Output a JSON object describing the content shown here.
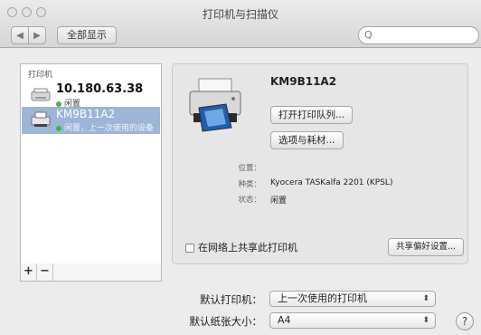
{
  "window": {
    "title": "打印机与扫描仪"
  },
  "toolbar": {
    "back_glyph": "◀",
    "forward_glyph": "▶",
    "show_all_label": "全部显示",
    "search_glyph": "Q",
    "search_value": ""
  },
  "printers": {
    "header": "打印机",
    "items": [
      {
        "name": "10.180.63.38",
        "status": "闲置",
        "selected": false
      },
      {
        "name": "KM9B11A2",
        "status": "闲置，上一次使用的设备",
        "selected": true
      }
    ],
    "add_label": "+",
    "remove_label": "−"
  },
  "details": {
    "name": "KM9B11A2",
    "open_queue_label": "打开打印队列...",
    "options_label": "选项与耗材...",
    "location_label": "位置：",
    "location_value": "",
    "kind_label": "种类：",
    "kind_value": "Kyocera TASKalfa 2201 (KPSL)",
    "status_label": "状态：",
    "status_value": "闲置",
    "share_label": "在网络上共享此打印机",
    "share_checked": false,
    "share_prefs_label": "共享偏好设置..."
  },
  "defaults": {
    "printer_label": "默认打印机：",
    "printer_value": "上一次使用的打印机",
    "paper_label": "默认纸张大小：",
    "paper_value": "A4",
    "popup_arrows": "⬍",
    "help_label": "?"
  },
  "colors": {
    "selection": "#9db5d6",
    "status_dot": "#3dbb3d"
  }
}
